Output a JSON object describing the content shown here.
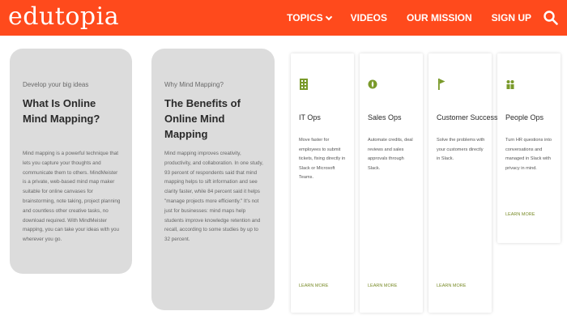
{
  "brand": {
    "logo_text": "edutopia"
  },
  "colors": {
    "header_bg": "#ff4a1c",
    "accent_green": "#7a9a2a"
  },
  "nav": {
    "topics": "TOPICS",
    "videos": "VIDEOS",
    "mission": "OUR MISSION",
    "signup": "SIGN UP"
  },
  "big_cards": [
    {
      "eyebrow": "Develop your big ideas",
      "title": "What Is Online Mind Mapping?",
      "body": "Mind mapping is a powerful technique that lets you capture your thoughts and communicate them to others. MindMeister is a private, web-based mind map maker suitable for online canvases for brainstorming, note taking, project planning and countless other creative tasks, no download required. With MindMeister mapping, you can take your ideas with you wherever you go."
    },
    {
      "eyebrow": "Why Mind Mapping?",
      "title": "The Benefits of Online Mind Mapping",
      "body": "Mind mapping improves creativity, productivity, and collaboration. In one study, 93 percent of respondents said that mind mapping helps to sift information and see clarity faster, while 84 percent said it helps \"manage projects more efficiently.\" It's not just for businesses: mind maps help students improve knowledge retention and recall, according to some studies by up to 32 percent."
    }
  ],
  "small_cards": [
    {
      "icon": "building-icon",
      "title": "IT Ops",
      "body": "Move faster for employees to submit tickets, fixing directly in Slack or Microsoft Teams.",
      "more": "LEARN MORE"
    },
    {
      "icon": "leaf-icon",
      "title": "Sales Ops",
      "body": "Automate credits, deal reviews and sales approvals through Slack.",
      "more": "LEARN MORE"
    },
    {
      "icon": "flag-icon",
      "title": "Customer Success",
      "body": "Solve the problems with your customers directly in Slack.",
      "more": "LEARN MORE"
    },
    {
      "icon": "people-icon",
      "title": "People Ops",
      "body": "Turn HR questions into conversations and managed in Slack with privacy in mind.",
      "more": "LEARN MORE"
    }
  ]
}
